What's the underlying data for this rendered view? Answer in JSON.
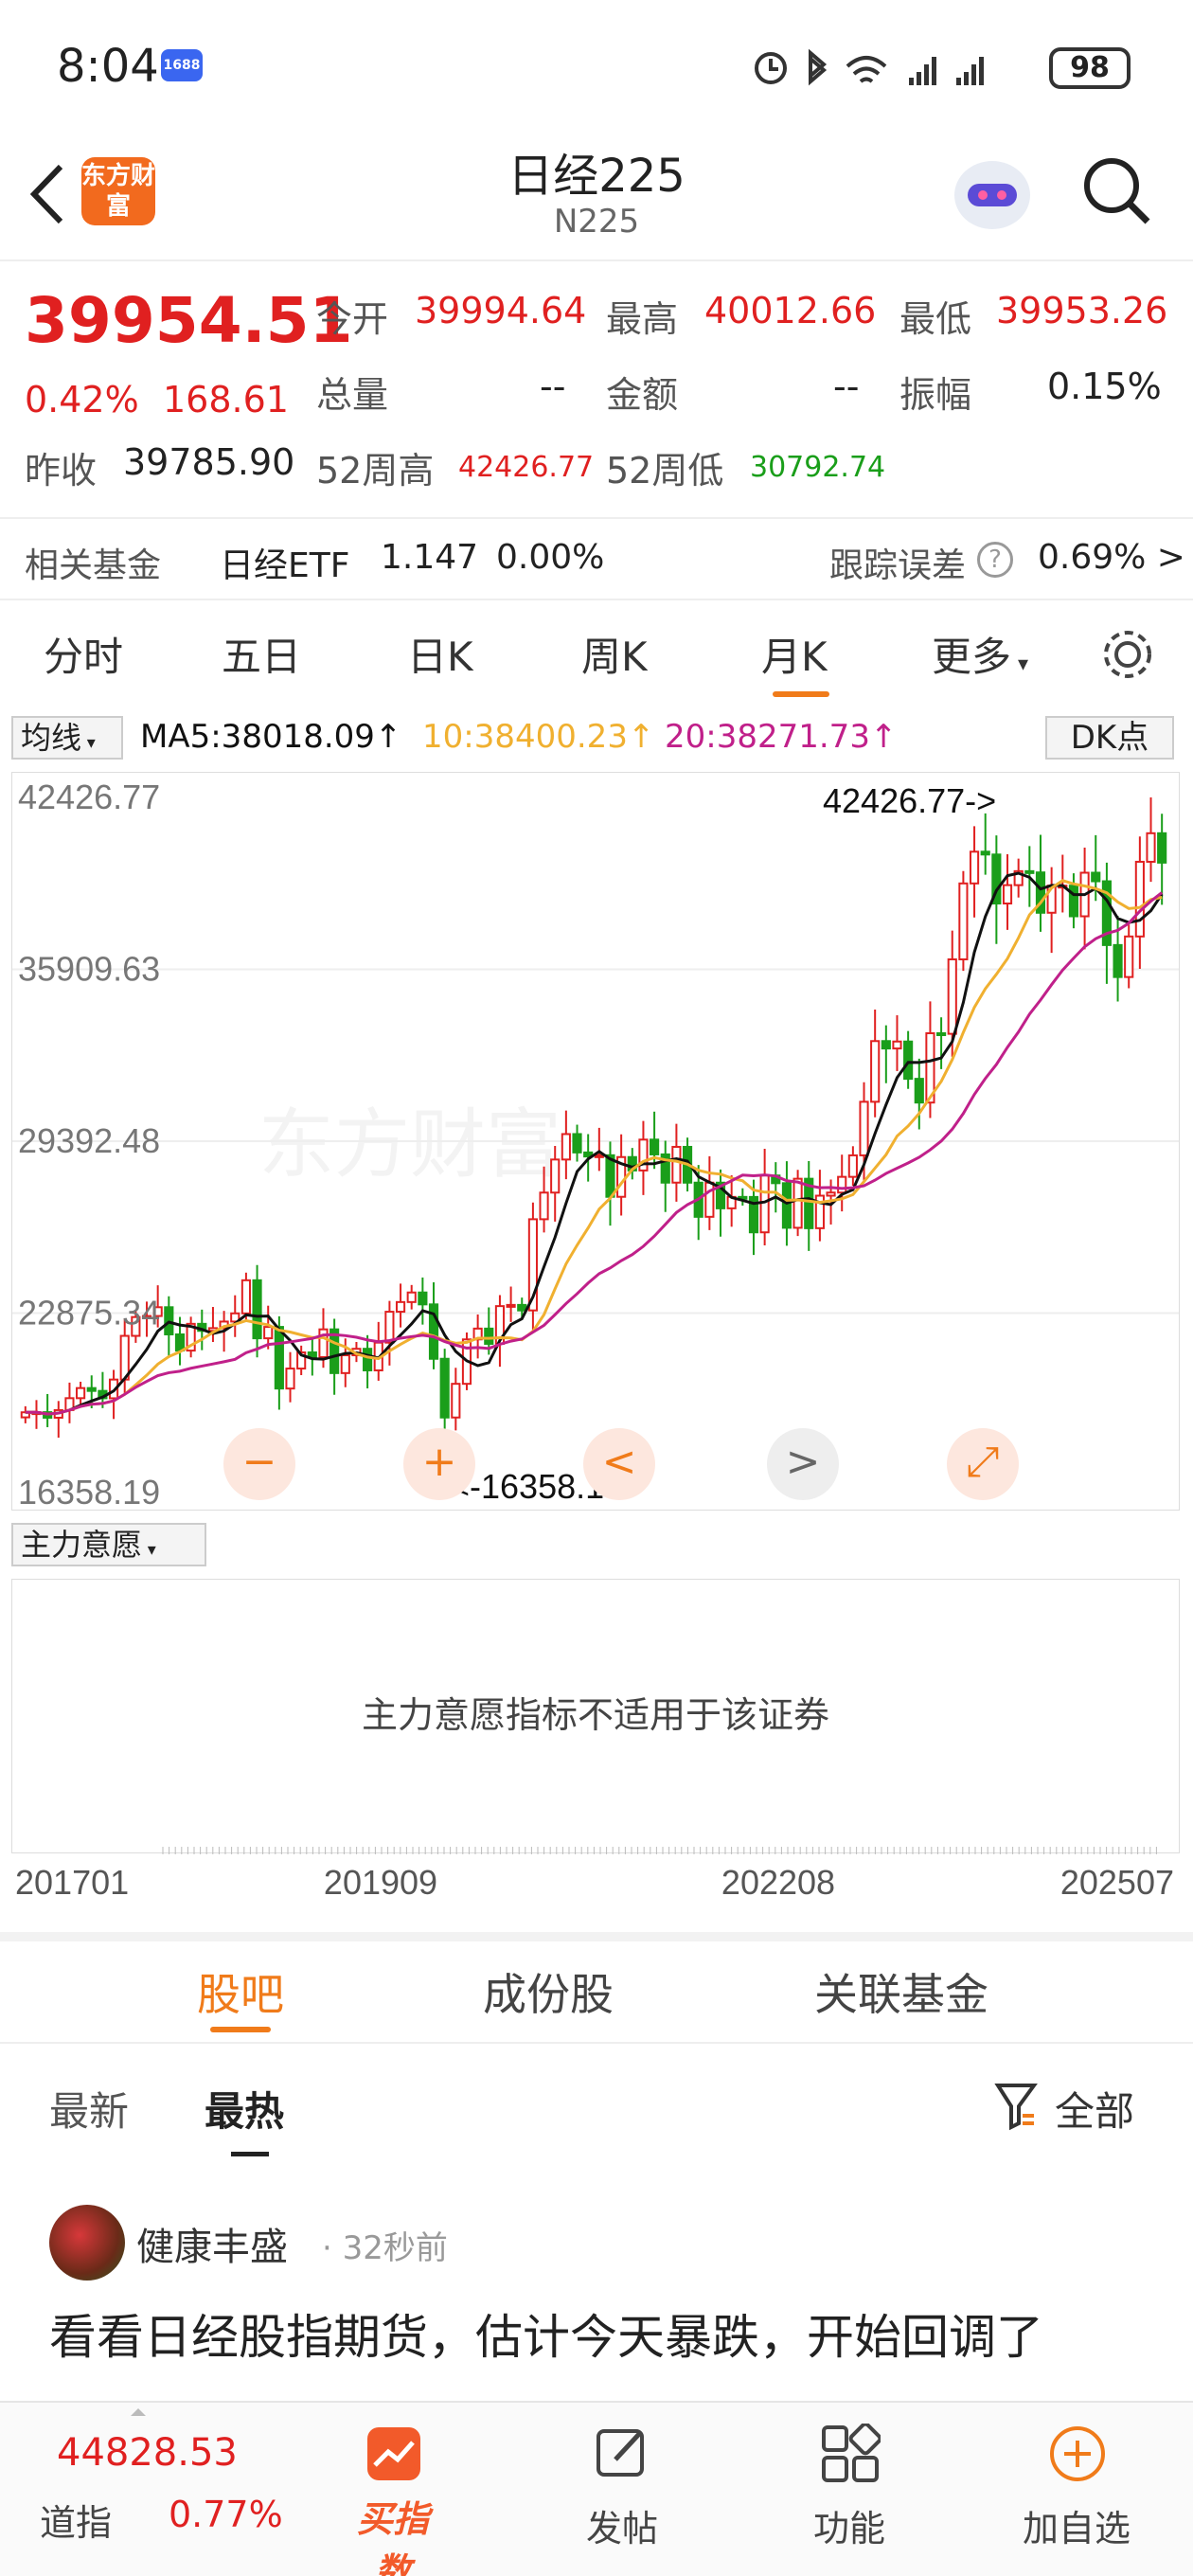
{
  "status": {
    "time": "8:04",
    "app_badge": "1688",
    "battery": "98"
  },
  "header": {
    "title": "日经225",
    "subtitle": "N225",
    "logo": "东方财富"
  },
  "quote": {
    "price": "39954.51",
    "pct": "0.42%",
    "chg": "168.61",
    "open_label": "今开",
    "open": "39994.64",
    "high_label": "最高",
    "high": "40012.66",
    "low_label": "最低",
    "low": "39953.26",
    "vol_label": "总量",
    "vol": "--",
    "amt_label": "金额",
    "amt": "--",
    "amp_label": "振幅",
    "amp": "0.15%",
    "prev_label": "昨收",
    "prev": "39785.90",
    "w52h_label": "52周高",
    "w52h": "42426.77",
    "w52l_label": "52周低",
    "w52l": "30792.74"
  },
  "fund": {
    "label": "相关基金",
    "name": "日经ETF",
    "price": "1.147",
    "pct": "0.00%",
    "track_label": "跟踪误差",
    "track": "0.69% >"
  },
  "tabs": [
    "分时",
    "五日",
    "日K",
    "周K",
    "月K",
    "更多"
  ],
  "ma": {
    "selector": "均线",
    "ma5": "MA5:38018.09↑",
    "ma10": "10:38400.23↑",
    "ma20": "20:38271.73↑",
    "dk": "DK点"
  },
  "chart_data": {
    "type": "candlestick",
    "yticks": [
      "42426.77",
      "35909.63",
      "29392.48",
      "22875.34",
      "16358.19"
    ],
    "ylim": [
      16358.19,
      42426.77
    ],
    "max_label": "42426.77->",
    "min_label": "<-16358.19",
    "xticks": [
      "201701",
      "201909",
      "202208",
      "202507"
    ],
    "close": [
      19114,
      19119,
      18909,
      19197,
      19650,
      20033,
      19925,
      19646,
      20356,
      22012,
      22725,
      22765,
      23098,
      22068,
      21454,
      22468,
      22202,
      22305,
      22554,
      22865,
      24120,
      21920,
      22351,
      20015,
      20773,
      21385,
      21206,
      22259,
      20601,
      21276,
      21522,
      20704,
      21756,
      22927,
      23294,
      23657,
      23205,
      21143,
      18917,
      20194,
      21878,
      22288,
      21710,
      23140,
      23185,
      22977,
      26434,
      27444,
      28698,
      29663,
      28966,
      28813,
      28860,
      27284,
      28791,
      28283,
      29453,
      28892,
      27822,
      29178,
      27821,
      26526,
      27821,
      26847,
      27280,
      27279,
      25937,
      28092,
      27801,
      26110,
      27969,
      26094,
      27327,
      27445,
      28041,
      28856,
      30887,
      33189,
      32908,
      33172,
      31758,
      30858,
      33486,
      33464,
      36287,
      39166,
      40369,
      40262,
      38405,
      39101,
      39631,
      39583,
      38054,
      39081,
      39081,
      37920,
      39572,
      39248,
      36830,
      35617,
      37155,
      39987,
      41069,
      39954
    ]
  },
  "chart_controls": {
    "zoom_out": "−",
    "zoom_in": "+",
    "prev": "<",
    "next": ">",
    "expand": "⤢"
  },
  "indicator": {
    "selector": "主力意愿",
    "message": "主力意愿指标不适用于该证券"
  },
  "section_tabs": [
    "股吧",
    "成份股",
    "关联基金"
  ],
  "feed": {
    "tab_new": "最新",
    "tab_hot": "最热",
    "filter": "全部",
    "post": {
      "author": "健康丰盛",
      "time": "32秒前",
      "text": "看看日经股指期货，估计今天暴跌，开始回调了"
    }
  },
  "bottom": {
    "idx_price": "44828.53",
    "idx_name": "道指",
    "idx_pct": "0.77%",
    "buy": "买指数",
    "post": "发帖",
    "func": "功能",
    "add": "加自选"
  },
  "colors": {
    "up": "#e02020",
    "down": "#1a9e1a",
    "accent": "#f07b1a",
    "ma5": "#111111",
    "ma10": "#f0b030",
    "ma20": "#c0208a"
  }
}
